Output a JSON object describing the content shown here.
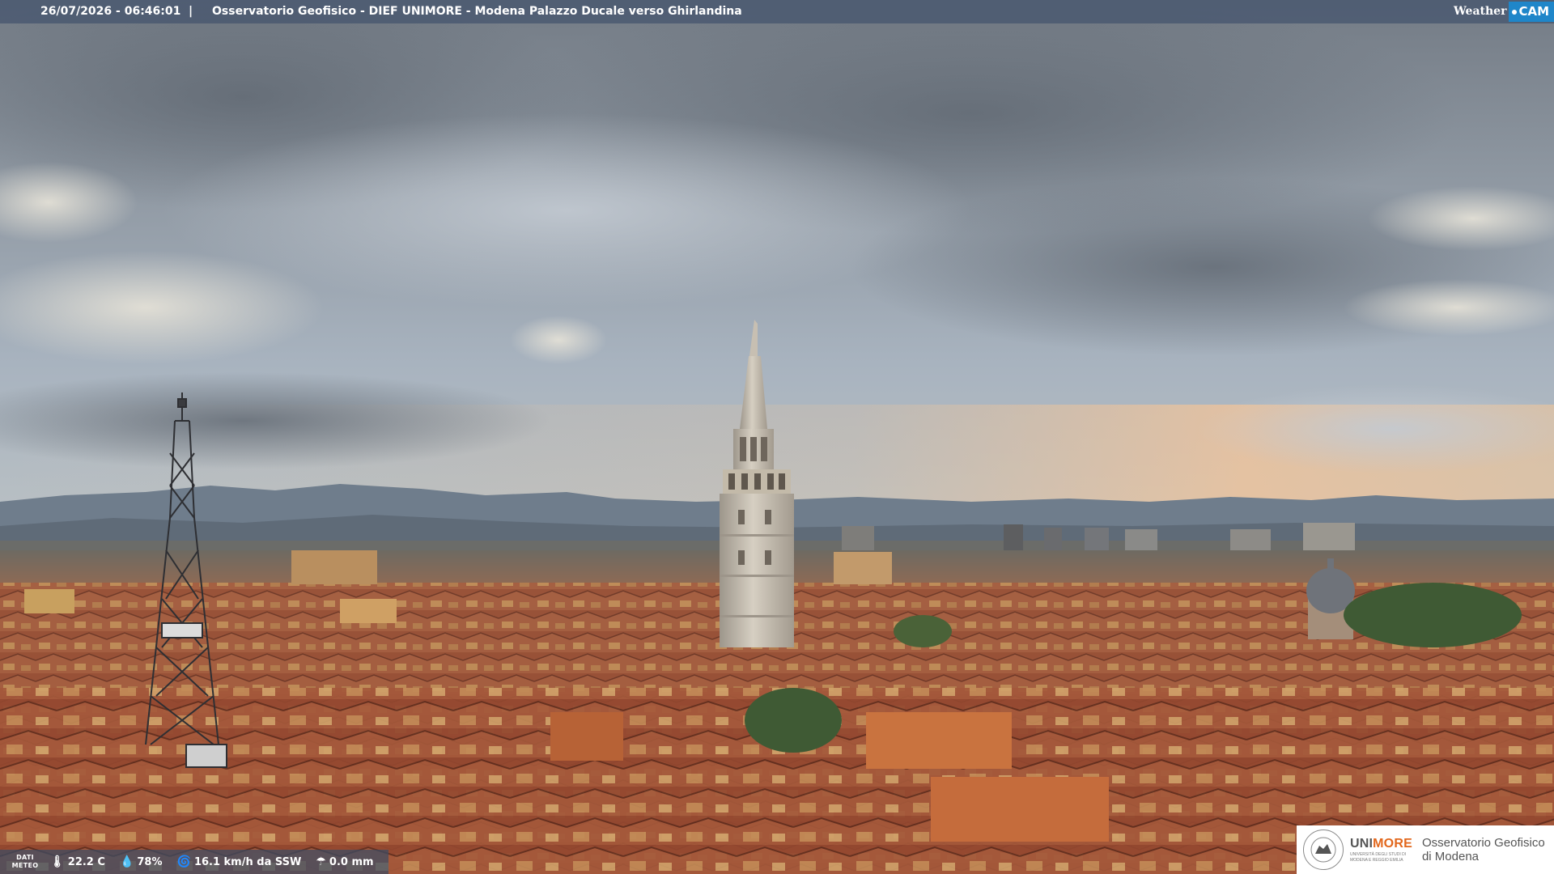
{
  "overlay": {
    "timestamp": "26/07/2026 - 06:46:01",
    "separator": "|",
    "title": "Osservatorio Geofisico - DIEF UNIMORE - Modena Palazzo Ducale verso Ghirlandina",
    "brand_weather": "Weather",
    "brand_cam": "CAM"
  },
  "weather": {
    "label_line1": "DATI",
    "label_line2": "METEO",
    "temperature": "22.2 C",
    "humidity": "78%",
    "wind": "16.1 km/h da SSW",
    "rain": "0.0 mm",
    "icons": [
      "thermometer-icon",
      "humidity-drop-icon",
      "wind-icon",
      "rain-icon"
    ]
  },
  "logo": {
    "uni_prefix": "UNI",
    "uni_suffix": "MORE",
    "uni_small_1": "UNIVERSITÀ DEGLI STUDI DI",
    "uni_small_2": "MODENA E REGGIO EMILIA",
    "obs_line1": "Osservatorio Geofisico",
    "obs_line2": "di Modena"
  },
  "colors": {
    "sky_top": "#7b838c",
    "sky_mid": "#a9b3bf",
    "horizon_glow": "#e9c49d",
    "mountains": "#6f7d8c",
    "roof": "#a65a3b",
    "tower": "#c9c0b0",
    "uni_accent": "#e2671c",
    "cam_blue": "#1f86c9"
  }
}
